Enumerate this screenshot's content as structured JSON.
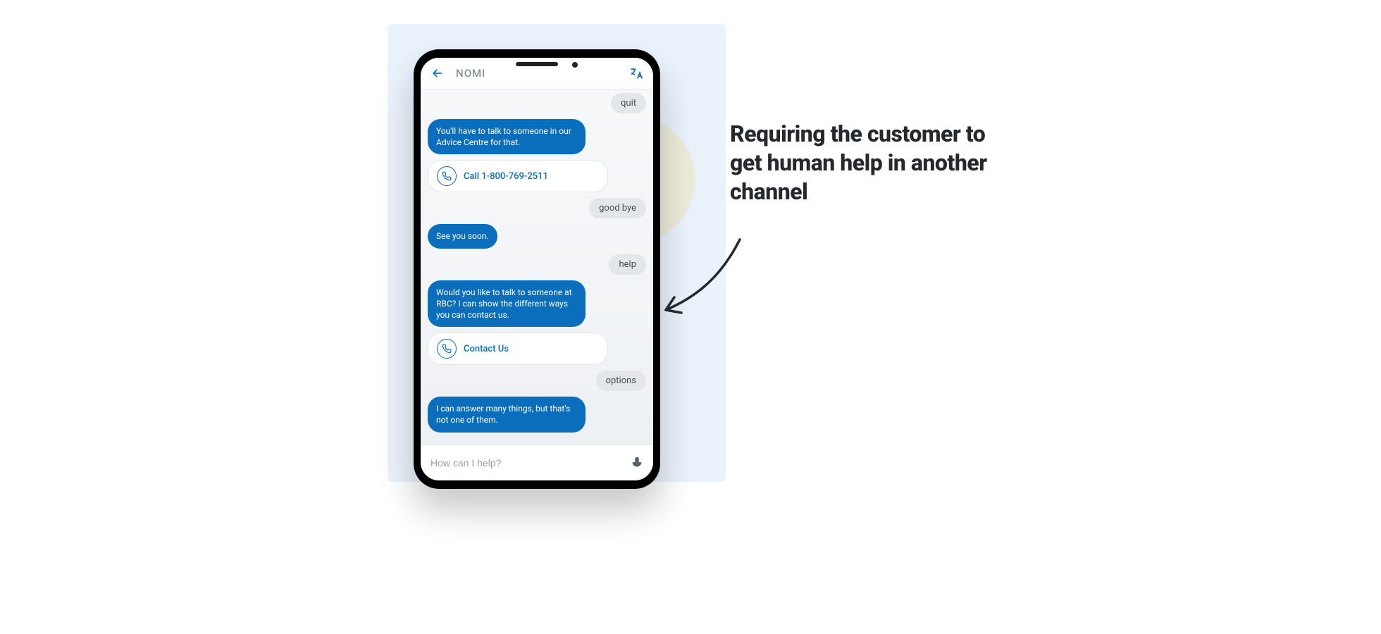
{
  "header": {
    "title": "NOMI"
  },
  "chat": {
    "m0_user": "quit",
    "m1_bot": "You'll have to talk to someone in our Advice Centre for that.",
    "m2_call": "Call 1-800-769-2511",
    "m3_user": "good bye",
    "m4_bot": "See you soon.",
    "m5_user": "help",
    "m6_bot": "Would you like to talk to someone at RBC? I can show the different ways you can contact us.",
    "m7_link": "Contact Us",
    "m8_user": "options",
    "m9_bot": "I can answer many things, but that's not one of them."
  },
  "composer": {
    "placeholder": "How can I help?"
  },
  "annotation": "Requiring the customer to get human help in another channel"
}
